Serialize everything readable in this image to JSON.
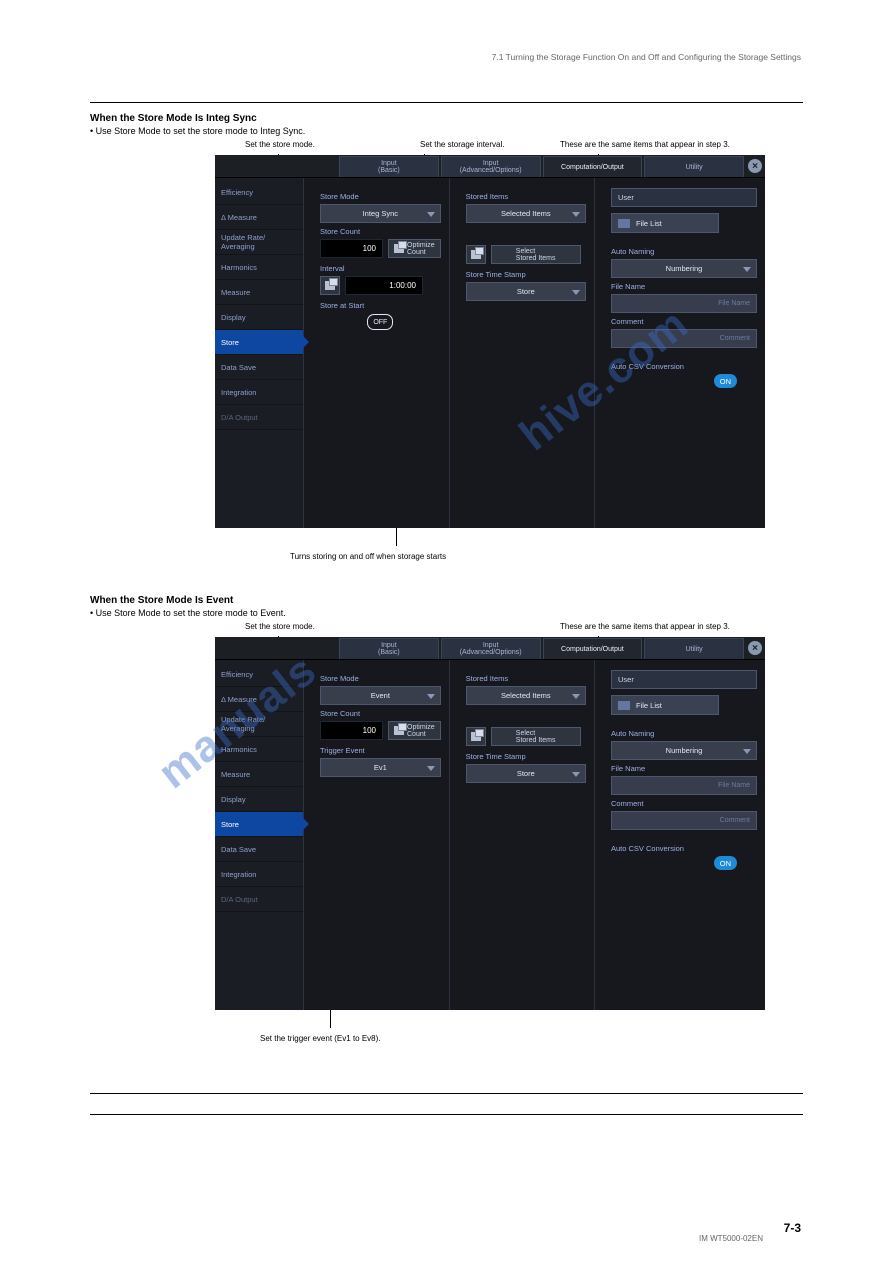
{
  "header_note": "7.1  Turning the Storage Function On and Off and Configuring the Storage Settings",
  "mode_section_1_title": "When the Store Mode Is Integ Sync",
  "mode_section_1_bullet": "Use Store Mode to set the store mode to Integ Sync.",
  "mode_section_2_title": "When the Store Mode Is Event",
  "mode_section_2_bullet": "Use Store Mode to set the store mode to Event.",
  "footer_page": "7-3",
  "footer_note": "IM WT5000-02EN",
  "callouts": {
    "top1_a": "Set the store mode.",
    "top1_b": "Set the storage interval.",
    "top1_c": "These are the same items that appear in step 3.",
    "below1": "Turns storing on and off when storage starts",
    "below2": "Set the trigger event (Ev1 to Ev8)."
  },
  "tabs": {
    "t1": "Input\n(Basic)",
    "t2": "Input\n(Advanced/Options)",
    "t3": "Computation/Output",
    "t4": "Utility"
  },
  "sidebar": {
    "s0": "Efficiency",
    "s1": "Δ Measure",
    "s2": "Update Rate/\nAveraging",
    "s3": "Harmonics",
    "s4": "Measure",
    "s5": "Display",
    "s6": "Store",
    "s7": "Data Save",
    "s8": "Integration",
    "s9": "D/A Output"
  },
  "shot1": {
    "store_mode_label": "Store Mode",
    "store_mode_value": "Integ Sync",
    "store_count_label": "Store Count",
    "store_count_value": "100",
    "optimize_btn": "Optimize\nCount",
    "interval_label": "Interval",
    "interval_value": "1:00:00",
    "store_at_start_label": "Store at Start",
    "off_pill": "OFF",
    "stored_items_label": "Stored Items",
    "stored_items_value": "Selected Items",
    "select_stored_btn": "Select\nStored Items",
    "store_time_stamp_label": "Store Time Stamp",
    "store_time_stamp_value": "Store",
    "user_label": "User",
    "file_list_btn": "File List",
    "auto_naming_label": "Auto Naming",
    "auto_naming_value": "Numbering",
    "file_name_label": "File Name",
    "file_name_ph": "File Name",
    "comment_label": "Comment",
    "comment_ph": "Comment",
    "auto_csv_label": "Auto CSV Conversion",
    "on_pill": "ON"
  },
  "shot2": {
    "store_mode_label": "Store Mode",
    "store_mode_value": "Event",
    "store_count_label": "Store Count",
    "store_count_value": "100",
    "optimize_btn": "Optimize\nCount",
    "trigger_event_label": "Trigger Event",
    "trigger_event_value": "Ev1",
    "stored_items_label": "Stored Items",
    "stored_items_value": "Selected Items",
    "select_stored_btn": "Select\nStored Items",
    "store_time_stamp_label": "Store Time Stamp",
    "store_time_stamp_value": "Store",
    "user_label": "User",
    "file_list_btn": "File List",
    "auto_naming_label": "Auto Naming",
    "auto_naming_value": "Numbering",
    "file_name_label": "File Name",
    "file_name_ph": "File Name",
    "comment_label": "Comment",
    "comment_ph": "Comment",
    "auto_csv_label": "Auto CSV Conversion",
    "on_pill": "ON"
  }
}
